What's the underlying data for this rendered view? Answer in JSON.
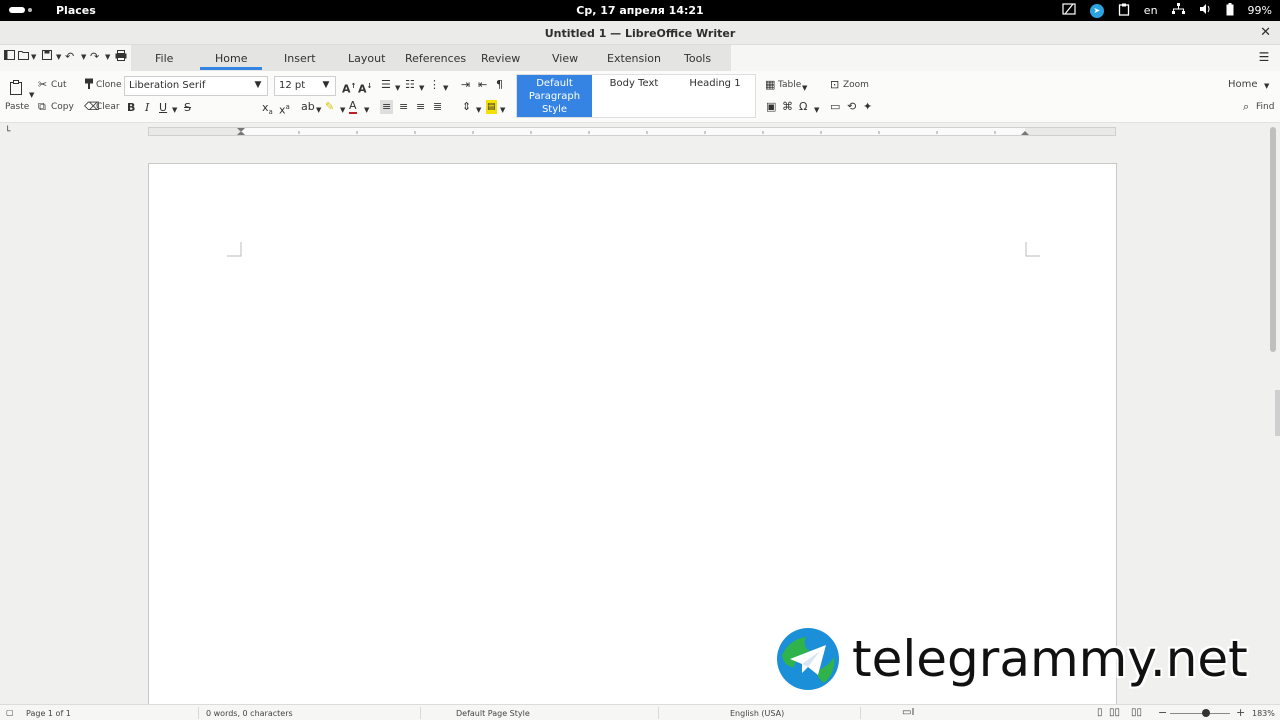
{
  "topbar": {
    "places": "Places",
    "clock": "Ср, 17 апреля  14:21",
    "lang": "en",
    "battery": "99%"
  },
  "window": {
    "title": "Untitled 1 — LibreOffice Writer",
    "close_glyph": "✕"
  },
  "tabs": [
    "File",
    "Home",
    "Insert",
    "Layout",
    "References",
    "Review",
    "View",
    "Extension",
    "Tools"
  ],
  "active_tab": "Home",
  "accent": "#3584e4",
  "ribbon": {
    "paste": "Paste",
    "cut": "Cut",
    "copy": "Copy",
    "clone": "Clone",
    "clear": "Clear",
    "font_name": "Liberation Serif",
    "font_size": "12 pt",
    "styles": {
      "default": "Default Paragraph Style",
      "body": "Body Text",
      "heading1": "Heading 1"
    },
    "table": "Table",
    "zoom": "Zoom",
    "home_dropdown": "Home",
    "find": "Find"
  },
  "statusbar": {
    "page": "Page 1 of 1",
    "words": "0 words, 0 characters",
    "page_style": "Default Page Style",
    "language": "English (USA)",
    "zoom": "183%"
  },
  "watermark": {
    "text": "telegrammy.net"
  }
}
